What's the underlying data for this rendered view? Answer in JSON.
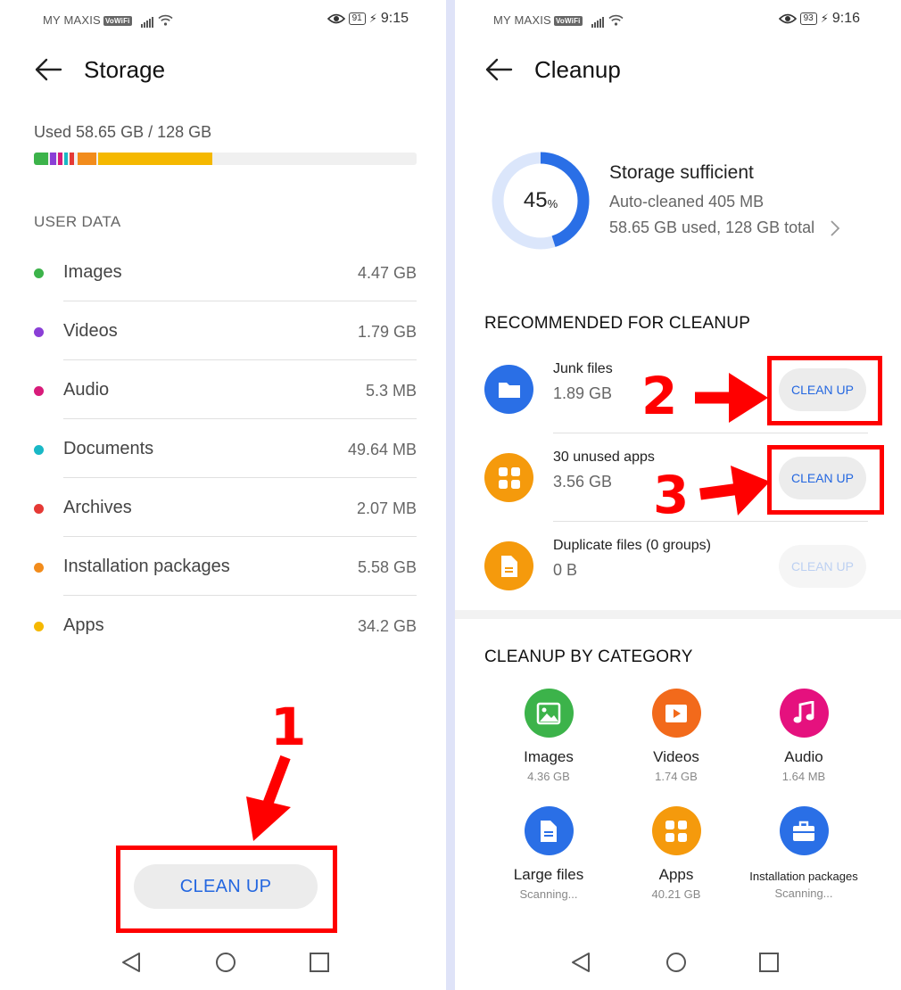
{
  "left": {
    "status": {
      "carrier": "MY MAXIS",
      "vowifi": "VoWiFi",
      "battery": "91",
      "time": "9:15"
    },
    "title": "Storage",
    "used_text": "Used 58.65 GB / 128 GB",
    "section_label": "USER DATA",
    "items": [
      {
        "name": "Images",
        "size": "4.47 GB",
        "color": "#3cb34a"
      },
      {
        "name": "Videos",
        "size": "1.79 GB",
        "color": "#8a3fd6"
      },
      {
        "name": "Audio",
        "size": "5.3 MB",
        "color": "#d81b7a"
      },
      {
        "name": "Documents",
        "size": "49.64 MB",
        "color": "#19b8c6"
      },
      {
        "name": "Archives",
        "size": "2.07 MB",
        "color": "#e53935"
      },
      {
        "name": "Installation packages",
        "size": "5.58 GB",
        "color": "#f28c1c"
      },
      {
        "name": "Apps",
        "size": "34.2 GB",
        "color": "#f5b800"
      }
    ],
    "cleanup_button": "CLEAN UP",
    "annotation": "1"
  },
  "right": {
    "status": {
      "carrier": "MY MAXIS",
      "vowifi": "VoWiFi",
      "battery": "93",
      "time": "9:16"
    },
    "title": "Cleanup",
    "ring_percent": "45",
    "ring_unit": "%",
    "ring_fraction": 0.45,
    "storage_title": "Storage sufficient",
    "auto_cleaned": "Auto-cleaned 405 MB",
    "usage": "58.65 GB used, 128 GB total",
    "recommended_heading": "RECOMMENDED FOR CLEANUP",
    "recommended": [
      {
        "name": "Junk files",
        "size": "1.89 GB",
        "button": "CLEAN UP",
        "icon": "folder-icon",
        "color": "#2a6fe6"
      },
      {
        "name": "30 unused apps",
        "size": "3.56 GB",
        "button": "CLEAN UP",
        "icon": "apps-grid-icon",
        "color": "#f59a0c"
      },
      {
        "name": "Duplicate files (0 groups)",
        "size": "0 B",
        "button": "CLEAN UP",
        "icon": "duplicate-files-icon",
        "color": "#f59a0c"
      }
    ],
    "category_heading": "CLEANUP BY CATEGORY",
    "categories": [
      {
        "name": "Images",
        "size": "4.36 GB",
        "icon": "image-icon",
        "color": "#3cb34a"
      },
      {
        "name": "Videos",
        "size": "1.74 GB",
        "icon": "video-icon",
        "color": "#f26a1b"
      },
      {
        "name": "Audio",
        "size": "1.64 MB",
        "icon": "music-icon",
        "color": "#e5117e"
      },
      {
        "name": "Large files",
        "size": "Scanning...",
        "icon": "file-icon",
        "color": "#2a6fe6"
      },
      {
        "name": "Apps",
        "size": "40.21 GB",
        "icon": "apps-grid-icon",
        "color": "#f59a0c"
      },
      {
        "name": "Installation packages",
        "size": "Scanning...",
        "icon": "briefcase-icon",
        "color": "#2a6fe6"
      }
    ],
    "annotations": [
      "2",
      "3"
    ]
  }
}
